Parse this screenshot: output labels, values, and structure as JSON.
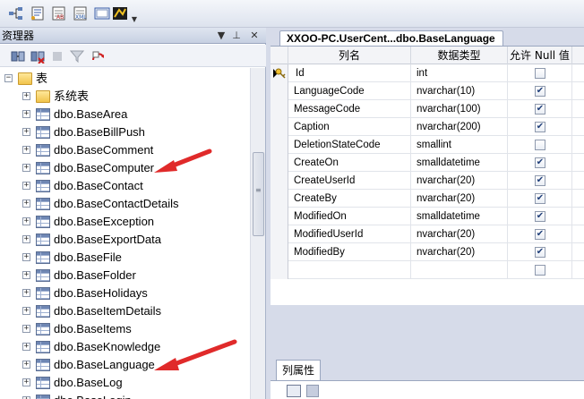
{
  "explorer": {
    "title": "资理器",
    "pin_glyph": "⊥",
    "close_glyph": "✕",
    "dropdown_glyph": "▼",
    "tree": [
      {
        "label": "表",
        "icon": "folder-icon",
        "expander": "−",
        "level": 0
      },
      {
        "label": "系统表",
        "icon": "folder-icon",
        "expander": "+",
        "level": 1
      },
      {
        "label": "dbo.BaseArea",
        "icon": "table-icon",
        "expander": "+",
        "level": 1
      },
      {
        "label": "dbo.BaseBillPush",
        "icon": "table-icon",
        "expander": "+",
        "level": 1
      },
      {
        "label": "dbo.BaseComment",
        "icon": "table-icon",
        "expander": "+",
        "level": 1
      },
      {
        "label": "dbo.BaseComputer",
        "icon": "table-icon",
        "expander": "+",
        "level": 1
      },
      {
        "label": "dbo.BaseContact",
        "icon": "table-icon",
        "expander": "+",
        "level": 1
      },
      {
        "label": "dbo.BaseContactDetails",
        "icon": "table-icon",
        "expander": "+",
        "level": 1
      },
      {
        "label": "dbo.BaseException",
        "icon": "table-icon",
        "expander": "+",
        "level": 1
      },
      {
        "label": "dbo.BaseExportData",
        "icon": "table-icon",
        "expander": "+",
        "level": 1
      },
      {
        "label": "dbo.BaseFile",
        "icon": "table-icon",
        "expander": "+",
        "level": 1
      },
      {
        "label": "dbo.BaseFolder",
        "icon": "table-icon",
        "expander": "+",
        "level": 1
      },
      {
        "label": "dbo.BaseHolidays",
        "icon": "table-icon",
        "expander": "+",
        "level": 1
      },
      {
        "label": "dbo.BaseItemDetails",
        "icon": "table-icon",
        "expander": "+",
        "level": 1
      },
      {
        "label": "dbo.BaseItems",
        "icon": "table-icon",
        "expander": "+",
        "level": 1
      },
      {
        "label": "dbo.BaseKnowledge",
        "icon": "table-icon",
        "expander": "+",
        "level": 1
      },
      {
        "label": "dbo.BaseLanguage",
        "icon": "table-icon",
        "expander": "+",
        "level": 1
      },
      {
        "label": "dbo.BaseLog",
        "icon": "table-icon",
        "expander": "+",
        "level": 1
      },
      {
        "label": "dbo.BaseLogin",
        "icon": "table-icon",
        "expander": "+",
        "level": 1
      }
    ]
  },
  "designer": {
    "tab_title": "XXOO-PC.UserCent...dbo.BaseLanguage",
    "headers": {
      "column_name": "列名",
      "data_type": "数据类型",
      "allow_null": "允许 Null 值"
    },
    "rows": [
      {
        "name": "Id",
        "type": "int",
        "nullable": false,
        "primary_key": true
      },
      {
        "name": "LanguageCode",
        "type": "nvarchar(10)",
        "nullable": true,
        "primary_key": false
      },
      {
        "name": "MessageCode",
        "type": "nvarchar(100)",
        "nullable": true,
        "primary_key": false
      },
      {
        "name": "Caption",
        "type": "nvarchar(200)",
        "nullable": true,
        "primary_key": false
      },
      {
        "name": "DeletionStateCode",
        "type": "smallint",
        "nullable": false,
        "primary_key": false
      },
      {
        "name": "CreateOn",
        "type": "smalldatetime",
        "nullable": true,
        "primary_key": false
      },
      {
        "name": "CreateUserId",
        "type": "nvarchar(20)",
        "nullable": true,
        "primary_key": false
      },
      {
        "name": "CreateBy",
        "type": "nvarchar(20)",
        "nullable": true,
        "primary_key": false
      },
      {
        "name": "ModifiedOn",
        "type": "smalldatetime",
        "nullable": true,
        "primary_key": false
      },
      {
        "name": "ModifiedUserId",
        "type": "nvarchar(20)",
        "nullable": true,
        "primary_key": false
      },
      {
        "name": "ModifiedBy",
        "type": "nvarchar(20)",
        "nullable": true,
        "primary_key": false
      },
      {
        "name": "",
        "type": "",
        "nullable": false,
        "primary_key": false
      }
    ],
    "properties_tab": "列属性",
    "check_glyph": "✔"
  },
  "colors": {
    "annotation_arrow": "#e02a2a",
    "pane_background": "#d6dbe9"
  }
}
